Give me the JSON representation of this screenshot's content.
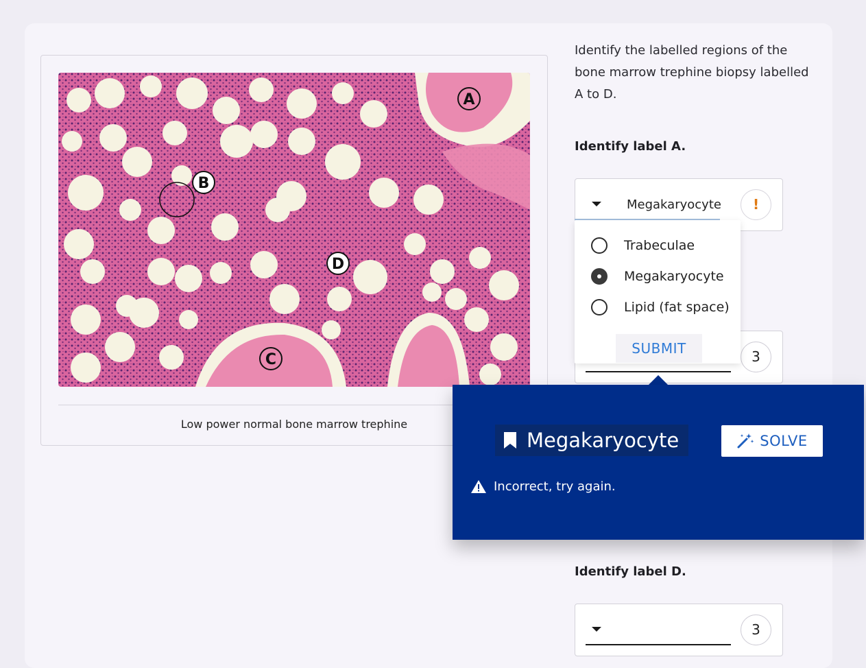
{
  "figure": {
    "caption": "Low power normal bone marrow trephine",
    "markers": [
      "A",
      "B",
      "C",
      "D"
    ]
  },
  "question": {
    "prompt": "Identify the labelled regions of the bone marrow trephine biopsy labelled A to D."
  },
  "label_a": {
    "heading": "Identify label A.",
    "selected": "Megakaryocyte",
    "status_icon": "warning-exclamation-icon",
    "status_symbol": "!"
  },
  "dropdown": {
    "options": [
      {
        "label": "Trabeculae",
        "selected": false
      },
      {
        "label": "Megakaryocyte",
        "selected": true
      },
      {
        "label": "Lipid (fat space)",
        "selected": false
      }
    ],
    "submit_label": "SUBMIT"
  },
  "label_b": {
    "attempts": "3"
  },
  "feedback_popup": {
    "answer": "Megakaryocyte",
    "answer_icon": "bookmark-icon",
    "solve_label": "SOLVE",
    "solve_icon": "magic-wand-icon",
    "message": "Incorrect, try again.",
    "message_icon": "warning-triangle-icon"
  },
  "label_d": {
    "heading": "Identify label D.",
    "attempts": "3"
  },
  "colors": {
    "popup_bg": "#002d8a",
    "accent_blue": "#2f7bd6",
    "warning_orange": "#e07a12",
    "tissue_pink": "#d9659e",
    "bone_pink": "#ea8ab0",
    "fat_white": "#f6f3e2"
  }
}
